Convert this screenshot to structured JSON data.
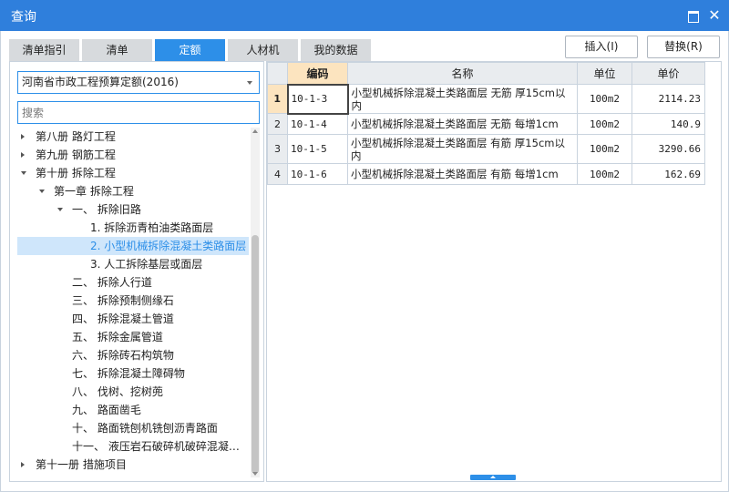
{
  "window": {
    "title": "查询"
  },
  "tabs": [
    {
      "label": "清单指引",
      "active": false
    },
    {
      "label": "清单",
      "active": false
    },
    {
      "label": "定额",
      "active": true
    },
    {
      "label": "人材机",
      "active": false
    },
    {
      "label": "我的数据",
      "active": false
    }
  ],
  "actions": {
    "insert_label": "插入(I)",
    "replace_label": "替换(R)"
  },
  "left": {
    "library_select": "河南省市政工程预算定额(2016)",
    "search_placeholder": "搜索",
    "tree": [
      {
        "label": "第八册 路灯工程",
        "expander": "right"
      },
      {
        "label": "第九册 钢筋工程",
        "expander": "right"
      },
      {
        "label": "第十册 拆除工程",
        "expander": "down"
      },
      {
        "label": "第一章 拆除工程",
        "expander": "down"
      },
      {
        "label": "一、 拆除旧路",
        "expander": "down"
      },
      {
        "label": "1. 拆除沥青柏油类路面层",
        "expander": "none"
      },
      {
        "label": "2. 小型机械拆除混凝土类路面层",
        "expander": "none",
        "selected": true
      },
      {
        "label": "3. 人工拆除基层或面层",
        "expander": "none"
      },
      {
        "label": "二、 拆除人行道",
        "expander": "none"
      },
      {
        "label": "三、 拆除预制侧缘石",
        "expander": "none"
      },
      {
        "label": "四、 拆除混凝土管道",
        "expander": "none"
      },
      {
        "label": "五、 拆除金属管道",
        "expander": "none"
      },
      {
        "label": "六、 拆除砖石构筑物",
        "expander": "none"
      },
      {
        "label": "七、 拆除混凝土障碍物",
        "expander": "none"
      },
      {
        "label": "八、 伐树、挖树蔸",
        "expander": "none"
      },
      {
        "label": "九、 路面凿毛",
        "expander": "none"
      },
      {
        "label": "十、 路面铣刨机铣刨沥青路面",
        "expander": "none"
      },
      {
        "label": "十一、 液压岩石破碎机破碎混凝土、钢筋混凝土",
        "expander": "none"
      },
      {
        "label": "第十一册 措施项目",
        "expander": "right"
      }
    ]
  },
  "grid": {
    "headers": {
      "code": "编码",
      "name": "名称",
      "unit": "单位",
      "price": "单价"
    },
    "rows": [
      {
        "no": "1",
        "code": "10-1-3",
        "name": "小型机械拆除混凝土类路面层 无筋 厚15cm以内",
        "unit": "100m2",
        "price": "2114.23"
      },
      {
        "no": "2",
        "code": "10-1-4",
        "name": "小型机械拆除混凝土类路面层 无筋 每增1cm",
        "unit": "100m2",
        "price": "140.9"
      },
      {
        "no": "3",
        "code": "10-1-5",
        "name": "小型机械拆除混凝土类路面层 有筋 厚15cm以内",
        "unit": "100m2",
        "price": "3290.66"
      },
      {
        "no": "4",
        "code": "10-1-6",
        "name": "小型机械拆除混凝土类路面层 有筋 每增1cm",
        "unit": "100m2",
        "price": "162.69"
      }
    ]
  },
  "colors": {
    "titlebar": "#2f7fdc",
    "accent": "#2d8fe8",
    "active_header": "#fce4bf"
  }
}
